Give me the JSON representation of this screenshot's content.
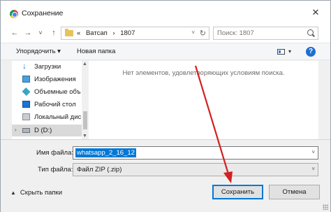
{
  "window": {
    "title": "Сохранение",
    "close_symbol": "✕"
  },
  "address": {
    "back_symbol": "←",
    "forward_symbol": "→",
    "recent_symbol": "˅",
    "up_symbol": "↑",
    "crumbs": [
      "«",
      "Ватсап",
      "›",
      "1807"
    ],
    "dropdown_symbol": "˅",
    "refresh_symbol": "↻"
  },
  "search": {
    "placeholder": "Поиск: 1807"
  },
  "toolbar": {
    "organize_label": "Упорядочить ▾",
    "new_folder_label": "Новая папка",
    "view_dropdown_symbol": "▾",
    "help_symbol": "?"
  },
  "sidebar": {
    "items": [
      {
        "label": "Загрузки",
        "icon": "download-icon"
      },
      {
        "label": "Изображения",
        "icon": "images-icon"
      },
      {
        "label": "Объемные объ",
        "icon": "3d-objects-icon"
      },
      {
        "label": "Рабочий стол",
        "icon": "desktop-icon"
      },
      {
        "label": "Локальный дис",
        "icon": "local-disk-icon"
      },
      {
        "label": "D (D:)",
        "icon": "drive-icon",
        "selected": true
      }
    ],
    "expand_symbol": "›"
  },
  "content": {
    "empty_message": "Нет элементов, удовлетворяющих условиям поиска."
  },
  "form": {
    "filename_label": "Имя файла:",
    "filename_value": "whatsapp_2_16_12",
    "filetype_label": "Тип файла:",
    "filetype_value": "Файл ZIP (.zip)",
    "dropdown_symbol": "˅",
    "hide_folders_caret": "▲",
    "hide_folders_label": "Скрыть папки",
    "save_label": "Сохранить",
    "cancel_label": "Отмена"
  },
  "colors": {
    "selection": "#0078d7",
    "annotation_arrow": "#d32020",
    "help_icon": "#1f6fd1"
  }
}
